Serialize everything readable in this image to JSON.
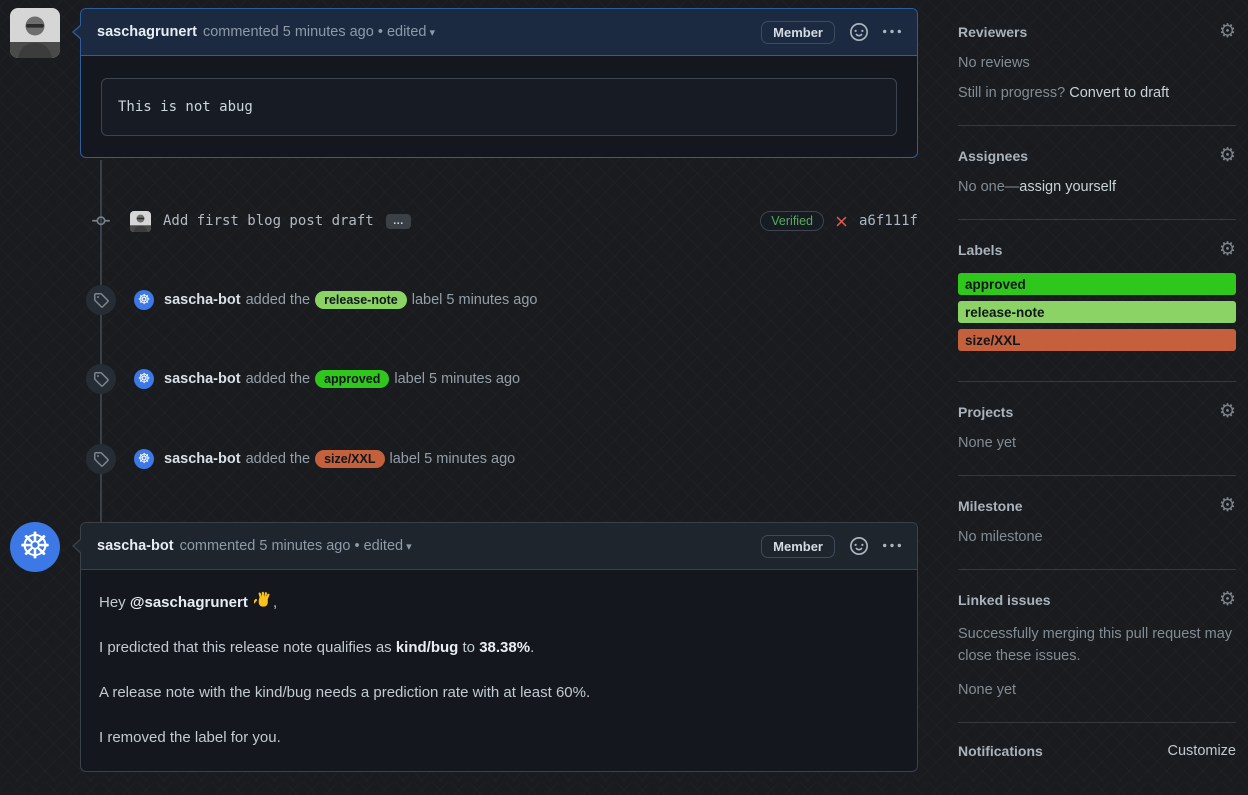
{
  "colors": {
    "label_approved": "#30c71c",
    "label_release_note": "#8bd364",
    "label_size_xxl": "#c4613c",
    "verified_green": "#57ab5a",
    "error_red": "#e5534b",
    "highlight_border": "#2e5d9b"
  },
  "comment1": {
    "author": "saschagrunert",
    "meta": "commented 5 minutes ago • edited",
    "caret": "▾",
    "member_badge": "Member",
    "code": "This is not abug"
  },
  "commit": {
    "message": "Add first blog post draft",
    "expander": "…",
    "verified": "Verified",
    "hash": "a6f111f"
  },
  "events": [
    {
      "actor": "sascha-bot",
      "action": "added the",
      "label": "release-note",
      "label_style": "background:#8bd364",
      "suffix": "label 5 minutes ago"
    },
    {
      "actor": "sascha-bot",
      "action": "added the",
      "label": "approved",
      "label_style": "background:#30c71c",
      "suffix": "label 5 minutes ago"
    },
    {
      "actor": "sascha-bot",
      "action": "added the",
      "label": "size/XXL",
      "label_style": "background:#c4613c",
      "suffix": "label 5 minutes ago"
    }
  ],
  "comment2": {
    "author": "sascha-bot",
    "meta": "commented 5 minutes ago • edited",
    "caret": "▾",
    "member_badge": "Member",
    "p1_prefix": "Hey ",
    "p1_mention": "@saschagrunert",
    "p1_suffix": ",",
    "p2_s1": "I predicted that this release note qualifies as ",
    "p2_b1": "kind/bug",
    "p2_s2": " to ",
    "p2_b2": "38.38%",
    "p2_s3": ".",
    "p3": "A release note with the kind/bug needs a prediction rate with at least 60%.",
    "p4": "I removed the label for you."
  },
  "sidebar": {
    "reviewers": {
      "title": "Reviewers",
      "empty": "No reviews",
      "hint_prefix": "Still in progress? ",
      "hint_link": "Convert to draft"
    },
    "assignees": {
      "title": "Assignees",
      "empty_prefix": "No one—",
      "empty_link": "assign yourself"
    },
    "labels": {
      "title": "Labels",
      "items": [
        {
          "name": "approved",
          "style": "background:#30c71c"
        },
        {
          "name": "release-note",
          "style": "background:#8bd364"
        },
        {
          "name": "size/XXL",
          "style": "background:#c4613c"
        }
      ]
    },
    "projects": {
      "title": "Projects",
      "empty": "None yet"
    },
    "milestone": {
      "title": "Milestone",
      "empty": "No milestone"
    },
    "linked_issues": {
      "title": "Linked issues",
      "description": "Successfully merging this pull request may close these issues.",
      "empty": "None yet"
    },
    "notifications": {
      "title": "Notifications",
      "action": "Customize"
    }
  }
}
